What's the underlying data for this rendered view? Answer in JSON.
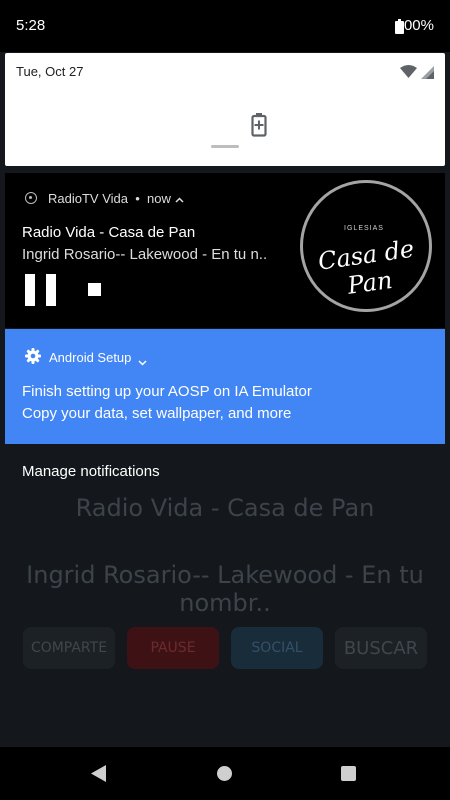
{
  "status_bar": {
    "time": "5:28",
    "battery_percent": "100%"
  },
  "quick_settings": {
    "date": "Tue, Oct 27"
  },
  "media_notification": {
    "app_name": "RadioTV Vida",
    "time_ago": "now",
    "title": "Radio Vida - Casa de Pan",
    "artist": "Ingrid Rosario-- Lakewood - En tu n..",
    "album_art": {
      "small_text": "IGLESIAS",
      "script_text": "Casa de Pan"
    }
  },
  "setup_notification": {
    "app_name": "Android Setup",
    "title": "Finish setting up your AOSP on IA Emulator",
    "subtitle": "Copy your data, set wallpaper, and more"
  },
  "manage_label": "Manage notifications",
  "background_app": {
    "station": "Radio Vida - Casa de Pan",
    "track": "Ingrid Rosario-- Lakewood - En tu nombr..",
    "buttons": {
      "share": "COMPARTE",
      "pause": "PAUSE",
      "social": "SOCIAL",
      "search": "BUSCAR"
    }
  },
  "colors": {
    "setup_accent": "#4285f4",
    "pause_button": "#3e1214",
    "social_button": "#182c3a"
  },
  "icons": [
    "battery-icon",
    "wifi-icon",
    "cell-signal-icon",
    "battery-saver-icon",
    "app-icon",
    "expand-chevron-icon",
    "pause-icon",
    "stop-icon",
    "gear-icon",
    "back-icon",
    "home-icon",
    "recents-icon"
  ]
}
